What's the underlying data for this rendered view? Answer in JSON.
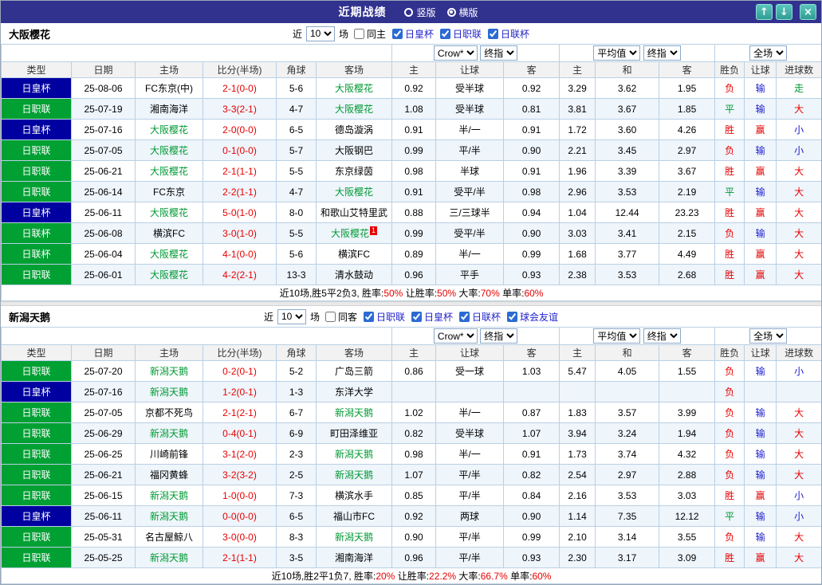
{
  "topbar": {
    "title": "近期战绩",
    "vertical_label": "竖版",
    "horizontal_label": "横版",
    "selected_layout": "横版",
    "up_glyph": "↑",
    "down_glyph": "↓",
    "close_glyph": "×"
  },
  "colors": {
    "topbar_bg": "#31318e",
    "button_teal": "#3aa89f",
    "badge_cup_blue": "#0000a0",
    "badge_league_green": "#00a033",
    "team_highlight_green": "#009933",
    "score_red": "#e60000",
    "loss_blue": "#1a1acd",
    "row_alt_bg": "#eef5fb",
    "grid_border": "#b9d0e5"
  },
  "sections": [
    {
      "team": "大阪樱花",
      "filter": {
        "near_label": "近",
        "count_value": "10",
        "games_label": "场",
        "checkboxes": [
          {
            "label": "同主",
            "checked": false,
            "blue": false
          },
          {
            "label": "日皇杯",
            "checked": true,
            "blue": true
          },
          {
            "label": "日职联",
            "checked": true,
            "blue": true
          },
          {
            "label": "日联杯",
            "checked": true,
            "blue": true
          }
        ]
      },
      "selects": {
        "odds_source": "Crow*",
        "odds_time": "终指",
        "avg_source": "平均值",
        "avg_time": "终指",
        "scope": "全场"
      },
      "columns": [
        "类型",
        "日期",
        "主场",
        "比分(半场)",
        "角球",
        "客场",
        "主",
        "让球",
        "客",
        "主",
        "和",
        "客",
        "胜负",
        "让球",
        "进球数"
      ],
      "rows": [
        {
          "type": "日皇杯",
          "badge": "cup",
          "date": "25-08-06",
          "home": "FC东京(中)",
          "score": "2-1(0-0)",
          "corners": "5-6",
          "away": "大阪樱花",
          "away_hl": true,
          "odds_home": "0.92",
          "odds_hcp": "受半球",
          "odds_away": "0.92",
          "avg_home": "3.29",
          "avg_draw": "3.62",
          "avg_away": "1.95",
          "result": "负",
          "result_color": "red",
          "hcp_result": "输",
          "hcp_color": "blue",
          "goals": "走",
          "goals_color": "green"
        },
        {
          "type": "日职联",
          "badge": "league",
          "date": "25-07-19",
          "home": "湘南海洋",
          "score": "3-3(2-1)",
          "corners": "4-7",
          "away": "大阪樱花",
          "away_hl": true,
          "odds_home": "1.08",
          "odds_hcp": "受半球",
          "odds_away": "0.81",
          "avg_home": "3.81",
          "avg_draw": "3.67",
          "avg_away": "1.85",
          "result": "平",
          "result_color": "green",
          "hcp_result": "输",
          "hcp_color": "blue",
          "goals": "大",
          "goals_color": "red"
        },
        {
          "type": "日皇杯",
          "badge": "cup",
          "date": "25-07-16",
          "home": "大阪樱花",
          "home_hl": true,
          "score": "2-0(0-0)",
          "corners": "6-5",
          "away": "德岛漩涡",
          "odds_home": "0.91",
          "odds_hcp": "半/一",
          "odds_away": "0.91",
          "avg_home": "1.72",
          "avg_draw": "3.60",
          "avg_away": "4.26",
          "result": "胜",
          "result_color": "red",
          "hcp_result": "赢",
          "hcp_color": "red",
          "goals": "小",
          "goals_color": "blue"
        },
        {
          "type": "日职联",
          "badge": "league",
          "date": "25-07-05",
          "home": "大阪樱花",
          "home_hl": true,
          "score": "0-1(0-0)",
          "corners": "5-7",
          "away": "大阪钢巴",
          "odds_home": "0.99",
          "odds_hcp": "平/半",
          "odds_away": "0.90",
          "avg_home": "2.21",
          "avg_draw": "3.45",
          "avg_away": "2.97",
          "result": "负",
          "result_color": "red",
          "hcp_result": "输",
          "hcp_color": "blue",
          "goals": "小",
          "goals_color": "blue"
        },
        {
          "type": "日职联",
          "badge": "league",
          "date": "25-06-21",
          "home": "大阪樱花",
          "home_hl": true,
          "score": "2-1(1-1)",
          "corners": "5-5",
          "away": "东京绿茵",
          "odds_home": "0.98",
          "odds_hcp": "半球",
          "odds_away": "0.91",
          "avg_home": "1.96",
          "avg_draw": "3.39",
          "avg_away": "3.67",
          "result": "胜",
          "result_color": "red",
          "hcp_result": "赢",
          "hcp_color": "red",
          "goals": "大",
          "goals_color": "red"
        },
        {
          "type": "日职联",
          "badge": "league",
          "date": "25-06-14",
          "home": "FC东京",
          "score": "2-2(1-1)",
          "corners": "4-7",
          "away": "大阪樱花",
          "away_hl": true,
          "odds_home": "0.91",
          "odds_hcp": "受平/半",
          "odds_away": "0.98",
          "avg_home": "2.96",
          "avg_draw": "3.53",
          "avg_away": "2.19",
          "result": "平",
          "result_color": "green",
          "hcp_result": "输",
          "hcp_color": "blue",
          "goals": "大",
          "goals_color": "red"
        },
        {
          "type": "日皇杯",
          "badge": "cup",
          "date": "25-06-11",
          "home": "大阪樱花",
          "home_hl": true,
          "score": "5-0(1-0)",
          "corners": "8-0",
          "away": "和歌山艾特里武",
          "odds_home": "0.88",
          "odds_hcp": "三/三球半",
          "odds_away": "0.94",
          "avg_home": "1.04",
          "avg_draw": "12.44",
          "avg_away": "23.23",
          "result": "胜",
          "result_color": "red",
          "hcp_result": "赢",
          "hcp_color": "red",
          "goals": "大",
          "goals_color": "red"
        },
        {
          "type": "日联杯",
          "badge": "league",
          "date": "25-06-08",
          "home": "横滨FC",
          "score": "3-0(1-0)",
          "corners": "5-5",
          "away": "大阪樱花",
          "away_hl": true,
          "away_card": "1",
          "odds_home": "0.99",
          "odds_hcp": "受平/半",
          "odds_away": "0.90",
          "avg_home": "3.03",
          "avg_draw": "3.41",
          "avg_away": "2.15",
          "result": "负",
          "result_color": "red",
          "hcp_result": "输",
          "hcp_color": "blue",
          "goals": "大",
          "goals_color": "red"
        },
        {
          "type": "日联杯",
          "badge": "league",
          "date": "25-06-04",
          "home": "大阪樱花",
          "home_hl": true,
          "score": "4-1(0-0)",
          "corners": "5-6",
          "away": "横滨FC",
          "odds_home": "0.89",
          "odds_hcp": "半/一",
          "odds_away": "0.99",
          "avg_home": "1.68",
          "avg_draw": "3.77",
          "avg_away": "4.49",
          "result": "胜",
          "result_color": "red",
          "hcp_result": "赢",
          "hcp_color": "red",
          "goals": "大",
          "goals_color": "red"
        },
        {
          "type": "日职联",
          "badge": "league",
          "date": "25-06-01",
          "home": "大阪樱花",
          "home_hl": true,
          "score": "4-2(2-1)",
          "corners": "13-3",
          "away": "清水鼓动",
          "odds_home": "0.96",
          "odds_hcp": "平手",
          "odds_away": "0.93",
          "avg_home": "2.38",
          "avg_draw": "3.53",
          "avg_away": "2.68",
          "result": "胜",
          "result_color": "red",
          "hcp_result": "赢",
          "hcp_color": "red",
          "goals": "大",
          "goals_color": "red"
        }
      ],
      "summary_parts": [
        {
          "text": "近10场,胜5平2负3, ",
          "color": "black"
        },
        {
          "text": "胜率:",
          "color": "black"
        },
        {
          "text": "50%",
          "color": "red"
        },
        {
          "text": " 让胜率:",
          "color": "black"
        },
        {
          "text": "50%",
          "color": "red"
        },
        {
          "text": " 大率:",
          "color": "black"
        },
        {
          "text": "70%",
          "color": "red"
        },
        {
          "text": " 单率:",
          "color": "black"
        },
        {
          "text": "60%",
          "color": "red"
        }
      ]
    },
    {
      "team": "新潟天鹅",
      "filter": {
        "near_label": "近",
        "count_value": "10",
        "games_label": "场",
        "checkboxes": [
          {
            "label": "同客",
            "checked": false,
            "blue": false
          },
          {
            "label": "日职联",
            "checked": true,
            "blue": true
          },
          {
            "label": "日皇杯",
            "checked": true,
            "blue": true
          },
          {
            "label": "日联杯",
            "checked": true,
            "blue": true
          },
          {
            "label": "球会友谊",
            "checked": true,
            "blue": true
          }
        ]
      },
      "selects": {
        "odds_source": "Crow*",
        "odds_time": "终指",
        "avg_source": "平均值",
        "avg_time": "终指",
        "scope": "全场"
      },
      "columns": [
        "类型",
        "日期",
        "主场",
        "比分(半场)",
        "角球",
        "客场",
        "主",
        "让球",
        "客",
        "主",
        "和",
        "客",
        "胜负",
        "让球",
        "进球数"
      ],
      "rows": [
        {
          "type": "日职联",
          "badge": "league",
          "date": "25-07-20",
          "home": "新潟天鹅",
          "home_hl": true,
          "score": "0-2(0-1)",
          "corners": "5-2",
          "away": "广岛三箭",
          "odds_home": "0.86",
          "odds_hcp": "受一球",
          "odds_away": "1.03",
          "avg_home": "5.47",
          "avg_draw": "4.05",
          "avg_away": "1.55",
          "result": "负",
          "result_color": "red",
          "hcp_result": "输",
          "hcp_color": "blue",
          "goals": "小",
          "goals_color": "blue"
        },
        {
          "type": "日皇杯",
          "badge": "cup",
          "date": "25-07-16",
          "home": "新潟天鹅",
          "home_hl": true,
          "score": "1-2(0-1)",
          "corners": "1-3",
          "away": "东洋大学",
          "odds_home": "",
          "odds_hcp": "",
          "odds_away": "",
          "avg_home": "",
          "avg_draw": "",
          "avg_away": "",
          "result": "负",
          "result_color": "red",
          "hcp_result": "",
          "goals": ""
        },
        {
          "type": "日职联",
          "badge": "league",
          "date": "25-07-05",
          "home": "京都不死鸟",
          "score": "2-1(2-1)",
          "corners": "6-7",
          "away": "新潟天鹅",
          "away_hl": true,
          "odds_home": "1.02",
          "odds_hcp": "半/一",
          "odds_away": "0.87",
          "avg_home": "1.83",
          "avg_draw": "3.57",
          "avg_away": "3.99",
          "result": "负",
          "result_color": "red",
          "hcp_result": "输",
          "hcp_color": "blue",
          "goals": "大",
          "goals_color": "red"
        },
        {
          "type": "日职联",
          "badge": "league",
          "date": "25-06-29",
          "home": "新潟天鹅",
          "home_hl": true,
          "score": "0-4(0-1)",
          "corners": "6-9",
          "away": "町田泽维亚",
          "odds_home": "0.82",
          "odds_hcp": "受半球",
          "odds_away": "1.07",
          "avg_home": "3.94",
          "avg_draw": "3.24",
          "avg_away": "1.94",
          "result": "负",
          "result_color": "red",
          "hcp_result": "输",
          "hcp_color": "blue",
          "goals": "大",
          "goals_color": "red"
        },
        {
          "type": "日职联",
          "badge": "league",
          "date": "25-06-25",
          "home": "川崎前锋",
          "score": "3-1(2-0)",
          "corners": "2-3",
          "away": "新潟天鹅",
          "away_hl": true,
          "odds_home": "0.98",
          "odds_hcp": "半/一",
          "odds_away": "0.91",
          "avg_home": "1.73",
          "avg_draw": "3.74",
          "avg_away": "4.32",
          "result": "负",
          "result_color": "red",
          "hcp_result": "输",
          "hcp_color": "blue",
          "goals": "大",
          "goals_color": "red"
        },
        {
          "type": "日职联",
          "badge": "league",
          "date": "25-06-21",
          "home": "福冈黄蜂",
          "score": "3-2(3-2)",
          "corners": "2-5",
          "away": "新潟天鹅",
          "away_hl": true,
          "odds_home": "1.07",
          "odds_hcp": "平/半",
          "odds_away": "0.82",
          "avg_home": "2.54",
          "avg_draw": "2.97",
          "avg_away": "2.88",
          "result": "负",
          "result_color": "red",
          "hcp_result": "输",
          "hcp_color": "blue",
          "goals": "大",
          "goals_color": "red"
        },
        {
          "type": "日职联",
          "badge": "league",
          "date": "25-06-15",
          "home": "新潟天鹅",
          "home_hl": true,
          "score": "1-0(0-0)",
          "corners": "7-3",
          "away": "横滨水手",
          "odds_home": "0.85",
          "odds_hcp": "平/半",
          "odds_away": "0.84",
          "avg_home": "2.16",
          "avg_draw": "3.53",
          "avg_away": "3.03",
          "result": "胜",
          "result_color": "red",
          "hcp_result": "赢",
          "hcp_color": "red",
          "goals": "小",
          "goals_color": "blue"
        },
        {
          "type": "日皇杯",
          "badge": "cup",
          "date": "25-06-11",
          "home": "新潟天鹅",
          "home_hl": true,
          "score": "0-0(0-0)",
          "corners": "6-5",
          "away": "福山市FC",
          "odds_home": "0.92",
          "odds_hcp": "两球",
          "odds_away": "0.90",
          "avg_home": "1.14",
          "avg_draw": "7.35",
          "avg_away": "12.12",
          "result": "平",
          "result_color": "green",
          "hcp_result": "输",
          "hcp_color": "blue",
          "goals": "小",
          "goals_color": "blue"
        },
        {
          "type": "日职联",
          "badge": "league",
          "date": "25-05-31",
          "home": "名古屋鲸八",
          "score": "3-0(0-0)",
          "corners": "8-3",
          "away": "新潟天鹅",
          "away_hl": true,
          "odds_home": "0.90",
          "odds_hcp": "平/半",
          "odds_away": "0.99",
          "avg_home": "2.10",
          "avg_draw": "3.14",
          "avg_away": "3.55",
          "result": "负",
          "result_color": "red",
          "hcp_result": "输",
          "hcp_color": "blue",
          "goals": "大",
          "goals_color": "red"
        },
        {
          "type": "日职联",
          "badge": "league",
          "date": "25-05-25",
          "home": "新潟天鹅",
          "home_hl": true,
          "score": "2-1(1-1)",
          "corners": "3-5",
          "away": "湘南海洋",
          "odds_home": "0.96",
          "odds_hcp": "平/半",
          "odds_away": "0.93",
          "avg_home": "2.30",
          "avg_draw": "3.17",
          "avg_away": "3.09",
          "result": "胜",
          "result_color": "red",
          "hcp_result": "赢",
          "hcp_color": "red",
          "goals": "大",
          "goals_color": "red"
        }
      ],
      "summary_parts": [
        {
          "text": "近10场,胜2平1负7, ",
          "color": "black"
        },
        {
          "text": "胜率:",
          "color": "black"
        },
        {
          "text": "20%",
          "color": "red"
        },
        {
          "text": " 让胜率:",
          "color": "black"
        },
        {
          "text": "22.2%",
          "color": "red"
        },
        {
          "text": " 大率:",
          "color": "black"
        },
        {
          "text": "66.7%",
          "color": "red"
        },
        {
          "text": " 单率:",
          "color": "black"
        },
        {
          "text": "60%",
          "color": "red"
        }
      ]
    }
  ]
}
